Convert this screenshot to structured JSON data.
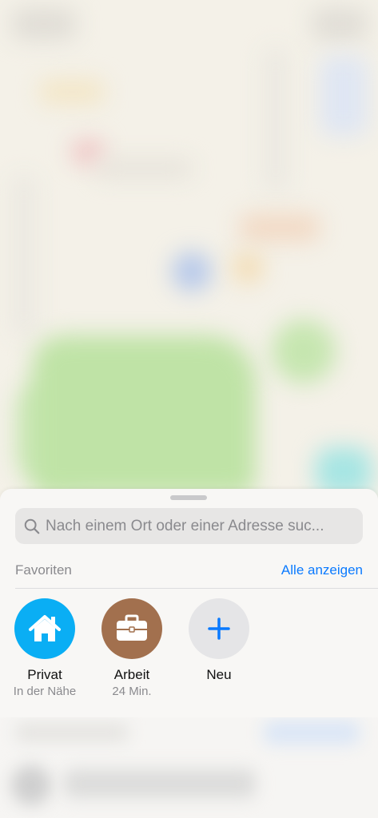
{
  "search": {
    "placeholder": "Nach einem Ort oder einer Adresse suc..."
  },
  "favorites": {
    "title": "Favoriten",
    "show_all": "Alle anzeigen",
    "items": [
      {
        "label": "Privat",
        "subtitle": "In der Nähe",
        "icon": "house-icon",
        "color": "#0aaef4"
      },
      {
        "label": "Arbeit",
        "subtitle": "24 Min.",
        "icon": "briefcase-icon",
        "color": "#a2704e"
      },
      {
        "label": "Neu",
        "subtitle": "",
        "icon": "plus-icon",
        "color": "#e5e5e7"
      }
    ]
  },
  "colors": {
    "accent": "#0a7aff",
    "home": "#0aaef4",
    "work": "#a2704e"
  }
}
